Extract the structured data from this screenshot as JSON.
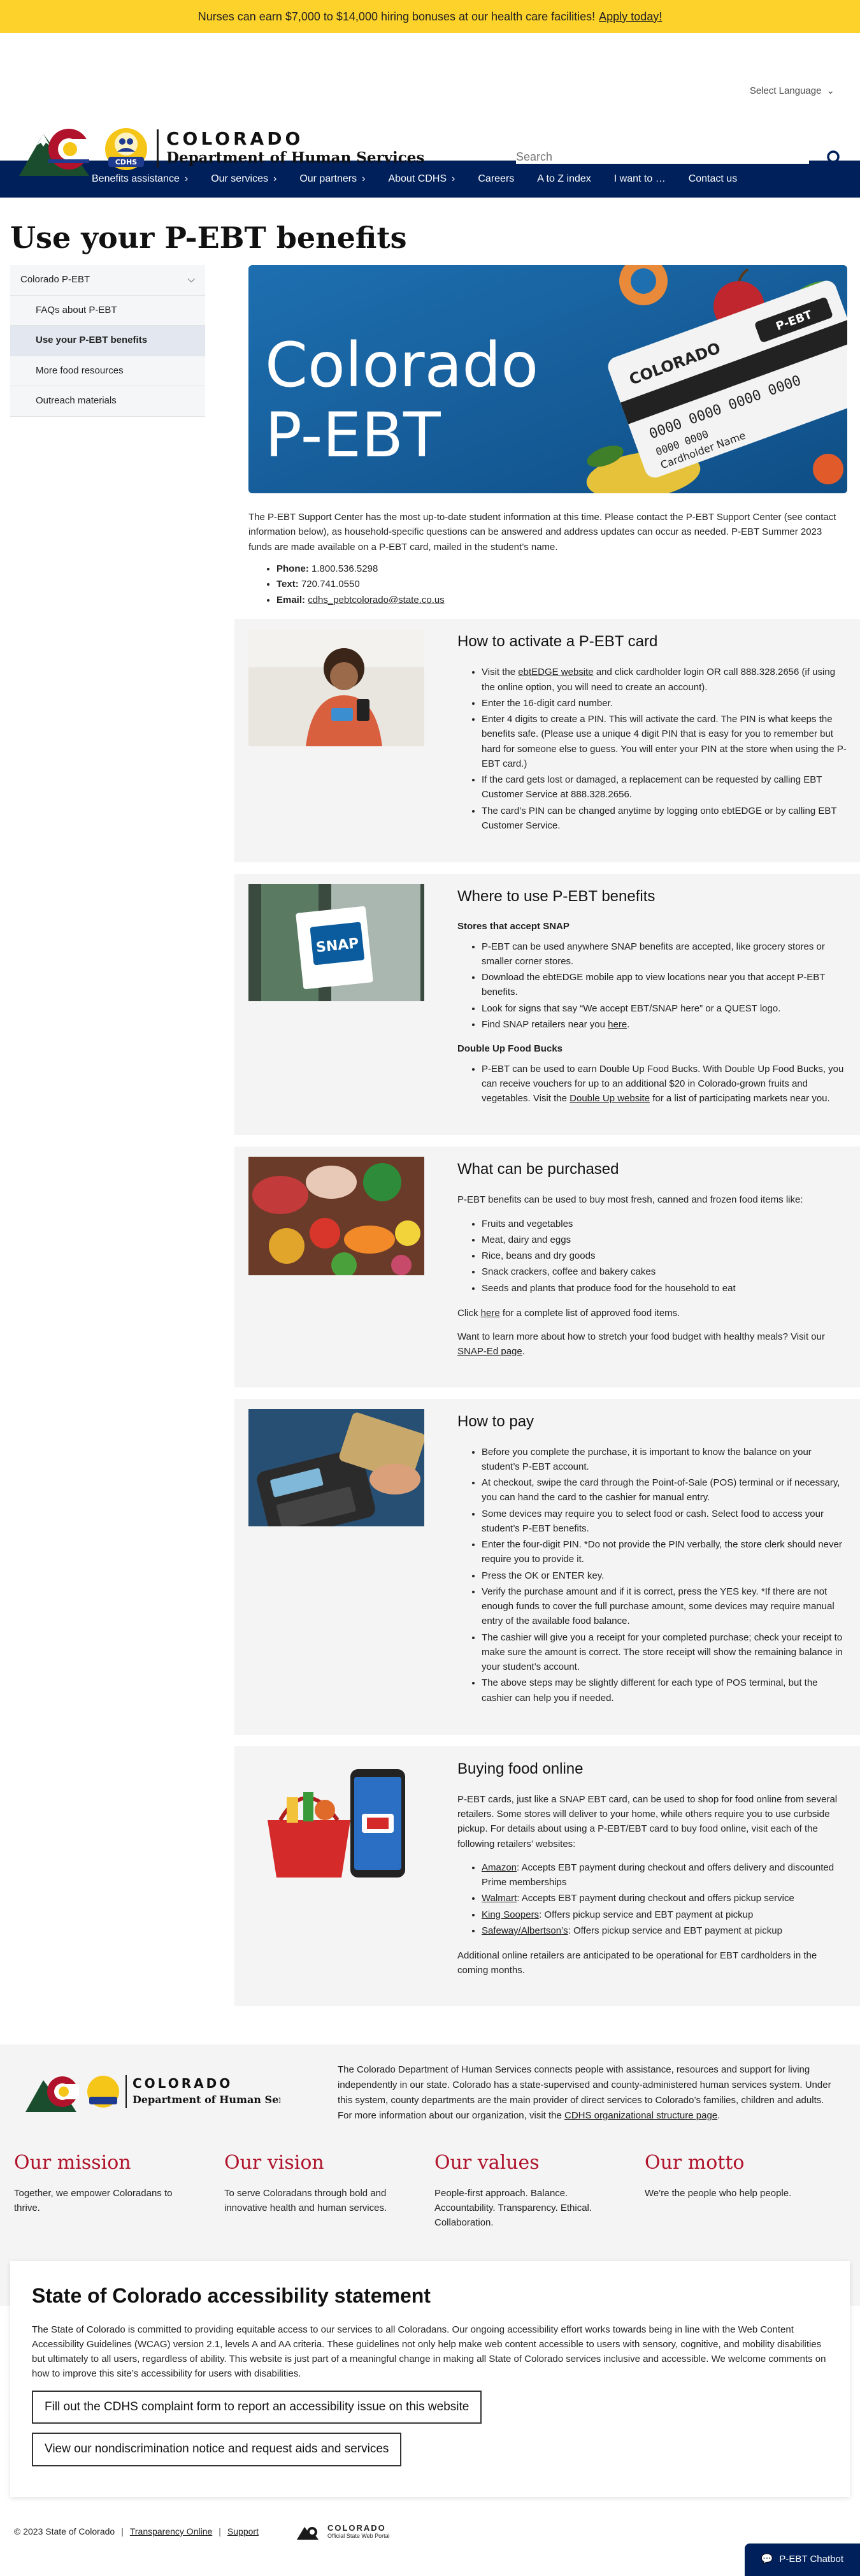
{
  "alert": {
    "text": "Nurses can earn $7,000 to $14,000 hiring bonuses at our health care facilities!",
    "link": "Apply today!"
  },
  "header": {
    "language": "Select Language",
    "logo_line1": "COLORADO",
    "logo_line2": "Department of Human Services",
    "logo_badge": "CDHS",
    "search_placeholder": "Search"
  },
  "nav": [
    {
      "label": "Benefits assistance",
      "chevron": true
    },
    {
      "label": "Our services",
      "chevron": true
    },
    {
      "label": "Our partners",
      "chevron": true
    },
    {
      "label": "About CDHS",
      "chevron": true
    },
    {
      "label": "Careers",
      "chevron": false
    },
    {
      "label": "A to Z index",
      "chevron": false
    },
    {
      "label": "I want to …",
      "chevron": false
    },
    {
      "label": "Contact us",
      "chevron": false
    }
  ],
  "page_title": "Use your P-EBT benefits",
  "sidenav": {
    "parent": "Colorado P-EBT",
    "items": [
      "FAQs about P-EBT",
      "Use your P-EBT benefits",
      "More food resources",
      "Outreach materials"
    ]
  },
  "hero": {
    "title1": "Colorado",
    "title2": "P-EBT",
    "card_state": "COLORADO",
    "card_brand": "P-EBT",
    "card_number1": "0000 0000 0000 0000",
    "card_number2": "0000 0000",
    "card_holder": "Cardholder Name"
  },
  "intro": {
    "text": "The P-EBT Support Center has the most up-to-date student information at this time. Please contact the P-EBT Support Center (see contact information below), as household-specific questions can be answered and address updates can occur as needed. P-EBT Summer 2023 funds are made available on a P-EBT card, mailed in the student’s name.",
    "phone_label": "Phone:",
    "phone": "1.800.536.5298",
    "text_label": "Text:",
    "text_number": "720.741.0550",
    "email_label": "Email:",
    "email": "cdhs_pebtcolorado@state.co.us"
  },
  "activate": {
    "title": "How to activate a P-EBT card",
    "item1_pre": "Visit the ",
    "item1_link": "ebtEDGE website",
    "item1_post": " and click cardholder login OR call 888.328.2656 (if using the online option, you will need to create an account).",
    "item2": "Enter the 16-digit card number.",
    "item3": "Enter 4 digits to create a PIN. This will activate the card. The PIN is what keeps the benefits safe. (Please use a unique 4 digit PIN that is easy for you to remember but hard for someone else to guess. You will enter your PIN at the store when using the P-EBT card.)",
    "item4": "If the card gets lost or damaged, a replacement can be requested by calling EBT Customer Service at 888.328.2656.",
    "item5": "The card’s PIN can be changed anytime by logging onto ebtEDGE or by calling EBT Customer Service."
  },
  "where": {
    "title": "Where to use P-EBT benefits",
    "sub1": "Stores that accept SNAP",
    "item1": "P-EBT can be used anywhere SNAP benefits are accepted, like grocery stores or smaller corner stores.",
    "item2": "Download the ebtEDGE mobile app to view locations near you that accept P-EBT benefits.",
    "item3": "Look for signs that say “We accept EBT/SNAP here” or a QUEST logo.",
    "item4_pre": "Find SNAP retailers near you ",
    "item4_link": "here",
    "item4_post": ".",
    "sub2": "Double Up Food Bucks",
    "item5_pre": "P-EBT can be used to earn Double Up Food Bucks. With Double Up Food Bucks, you can receive vouchers for up to an additional $20 in Colorado-grown fruits and vegetables. Visit the ",
    "item5_link": "Double Up website",
    "item5_post": " for a list of participating markets near you.",
    "sign_text": "SNAP"
  },
  "purchase": {
    "title": "What can be purchased",
    "intro": "P-EBT benefits can be used to buy most fresh, canned and frozen food items like:",
    "items": [
      "Fruits and vegetables",
      "Meat, dairy and eggs",
      "Rice, beans and dry goods",
      "Snack crackers, coffee and bakery cakes",
      "Seeds and plants that produce food for the household to eat"
    ],
    "click_pre": "Click ",
    "click_link": "here",
    "click_post": " for a complete list of approved food items.",
    "learn_pre": "Want to learn more about how to stretch your food budget with healthy meals? Visit our ",
    "learn_link": "SNAP-Ed page",
    "learn_post": "."
  },
  "pay": {
    "title": "How to pay",
    "items": [
      "Before you complete the purchase, it is important to know the balance on your student’s P-EBT account.",
      "At checkout, swipe the card through the Point-of-Sale (POS) terminal or if necessary, you can hand the card to the cashier for manual entry.",
      "Some devices may require you to select food or cash. Select food to access your student’s P-EBT benefits.",
      "Enter the four-digit PIN. *Do not provide the PIN verbally, the store clerk should never require you to provide it.",
      "Press the OK or ENTER key.",
      "Verify the purchase amount and if it is correct, press the YES key. *If there are not enough funds to cover the full purchase amount, some devices may require manual entry of the available food balance.",
      "The cashier will give you a receipt for your completed purchase; check your receipt to make sure the amount is correct. The store receipt will show the remaining balance in your student’s account.",
      "The above steps may be slightly different for each type of POS terminal, but the cashier can help you if needed."
    ]
  },
  "online": {
    "title": "Buying food online",
    "intro": "P-EBT cards, just like a SNAP EBT card, can be used to shop for food online from several retailers. Some stores will deliver to your home, while others require you to use curbside pickup. For details about using a P-EBT/EBT card to buy food online, visit each of the following retailers’ websites:",
    "r1_link": "Amazon",
    "r1_text": ": Accepts EBT payment during checkout and offers delivery and discounted Prime memberships",
    "r2_link": "Walmart",
    "r2_text": ": Accepts EBT payment during checkout and offers pickup service",
    "r3_link": "King Soopers",
    "r3_text": ": Offers pickup service and EBT payment at pickup",
    "r4_link": "Safeway/Albertson’s",
    "r4_text": ": Offers pickup service and EBT payment at pickup",
    "outro": "Additional online retailers are anticipated to be operational for EBT cardholders in the coming months."
  },
  "footer": {
    "about_pre": "The Colorado Department of Human Services connects people with assistance, resources and support for living independently in our state. Colorado has a state-supervised and county-administered human services system. Under this system, county departments are the main provider of direct services to Colorado’s families, children and adults. For more information about our organization, visit the ",
    "about_link": "CDHS organizational structure page",
    "about_post": ".",
    "values": [
      {
        "title": "Our mission",
        "text": "Together, we empower Coloradans to thrive."
      },
      {
        "title": "Our vision",
        "text": "To serve Coloradans through bold and innovative health and human services."
      },
      {
        "title": "Our values",
        "text": "People-first approach. Balance. Accountability. Transparency. Ethical. Collaboration."
      },
      {
        "title": "Our motto",
        "text": "We're the people who help people."
      }
    ],
    "access_title": "State of Colorado accessibility statement",
    "access_text": "The State of Colorado is committed to providing equitable access to our services to all Coloradans. Our ongoing accessibility effort works towards being in line with the Web Content Accessibility Guidelines (WCAG) version 2.1, levels A and AA criteria. These guidelines not only help make web content accessible to users with sensory, cognitive, and mobility disabilities but ultimately to all users, regardless of ability. This website is just part of a meaningful change in making all State of Colorado services inclusive and accessible. We welcome comments on how to improve this site’s accessibility for users with disabilities.",
    "btn1": "Fill out the CDHS complaint form to report an accessibility issue on this website",
    "btn2": "View our nondiscrimination notice and request aids and services",
    "copyright": "© 2023 State of Colorado",
    "link1": "Transparency Online",
    "link2": "Support",
    "state_logo": "COLORADO",
    "state_logo_sub": "Official State Web Portal",
    "chatbot": "P-EBT Chatbot"
  }
}
